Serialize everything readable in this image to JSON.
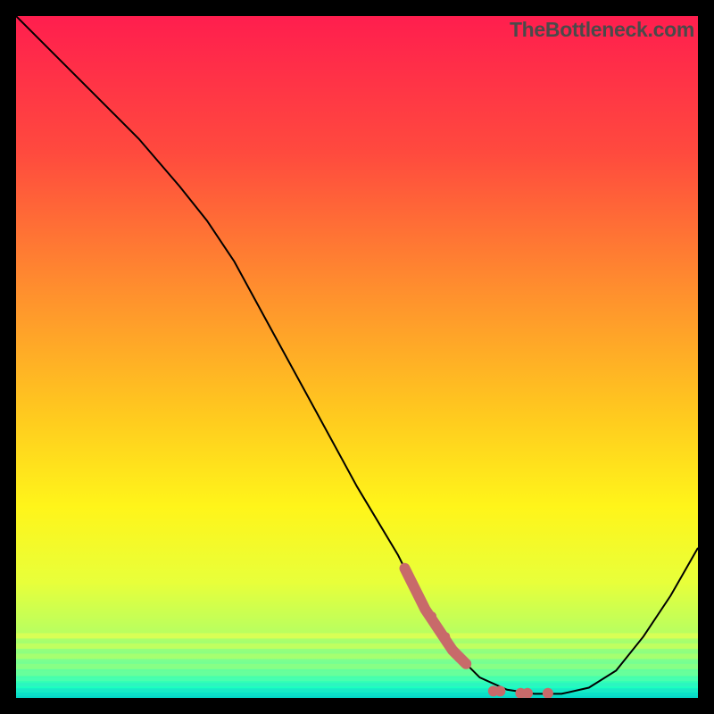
{
  "watermark": "TheBottleneck.com",
  "chart_data": {
    "type": "line",
    "title": "",
    "xlabel": "",
    "ylabel": "",
    "xlim": [
      0,
      100
    ],
    "ylim": [
      0,
      100
    ],
    "x": [
      0,
      6,
      12,
      18,
      24,
      28,
      32,
      38,
      44,
      50,
      56,
      60,
      64,
      68,
      72,
      76,
      80,
      84,
      88,
      92,
      96,
      100
    ],
    "y": [
      100,
      94,
      88,
      82,
      75,
      70,
      64,
      53,
      42,
      31,
      21,
      13,
      7,
      3,
      1.2,
      0.6,
      0.6,
      1.5,
      4,
      9,
      15,
      22
    ],
    "annotations_scatter": {
      "x": [
        59,
        60,
        61,
        62,
        63,
        64,
        65,
        70,
        71,
        74,
        75,
        78
      ],
      "y": [
        15,
        13,
        12,
        10,
        9,
        7,
        6,
        1,
        1,
        0.7,
        0.7,
        0.7
      ]
    },
    "gradient_bands": [
      {
        "stop": 0.0,
        "color": "#ff1e4e"
      },
      {
        "stop": 0.2,
        "color": "#ff4a3e"
      },
      {
        "stop": 0.4,
        "color": "#ff8e2e"
      },
      {
        "stop": 0.58,
        "color": "#ffc81f"
      },
      {
        "stop": 0.72,
        "color": "#fff51a"
      },
      {
        "stop": 0.83,
        "color": "#e8ff3a"
      },
      {
        "stop": 0.905,
        "color": "#b8ff60"
      },
      {
        "stop": 0.955,
        "color": "#6cff9a"
      },
      {
        "stop": 0.985,
        "color": "#1affc0"
      },
      {
        "stop": 1.0,
        "color": "#00e8c8"
      }
    ],
    "marker_color": "#c86a6a",
    "line_color": "#000000"
  }
}
